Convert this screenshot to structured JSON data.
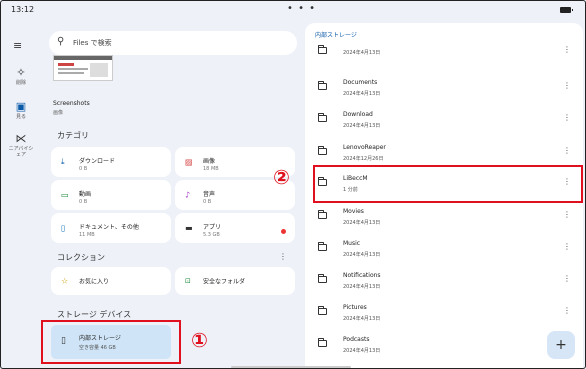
{
  "status": {
    "time": "13:12",
    "dots": "• • •"
  },
  "rail": {
    "items": [
      {
        "name": "rail-item-clean",
        "icon": "✧",
        "label": "削除"
      },
      {
        "name": "rail-item-browse",
        "icon": "▣",
        "label": "見る"
      },
      {
        "name": "rail-item-nearby-share",
        "icon": "⋉",
        "label": "ニアバイシェア"
      }
    ]
  },
  "search": {
    "placeholder": "Files で検索"
  },
  "screenshots": {
    "title": "Screenshots",
    "subtitle": "画像"
  },
  "categories": {
    "heading": "カテゴリ",
    "items": [
      {
        "name": "downloads",
        "icon": "⤓",
        "label": "ダウンロード",
        "sub": "0 B",
        "color": "#0b5aa8"
      },
      {
        "name": "images",
        "icon": "▨",
        "label": "画像",
        "sub": "18 MB",
        "color": "#d33b3b"
      },
      {
        "name": "videos",
        "icon": "▭",
        "label": "動画",
        "sub": "0 B",
        "color": "#1d8a3a"
      },
      {
        "name": "audio",
        "icon": "♪",
        "label": "音声",
        "sub": "0 B",
        "color": "#a336c9"
      },
      {
        "name": "documents",
        "icon": "▯",
        "label": "ドキュメント、その他",
        "sub": "11 MB",
        "color": "#0b6fb8"
      },
      {
        "name": "apps",
        "icon": "▬",
        "label": "アプリ",
        "sub": "5.3 GB",
        "color": "#333333"
      }
    ]
  },
  "collections": {
    "heading": "コレクション",
    "items": [
      {
        "name": "favorites",
        "icon": "☆",
        "label": "お気に入り",
        "color": "#c99b00"
      },
      {
        "name": "safe-folder",
        "icon": "🔒",
        "label": "安全なフォルダ",
        "color": "#1d8a3a"
      }
    ]
  },
  "storage": {
    "heading": "ストレージ デバイス",
    "internal": {
      "label": "内部ストレージ",
      "sub": "空き容量 46 GB"
    }
  },
  "annotations": {
    "one": "①",
    "two": "②"
  },
  "right": {
    "breadcrumb": "内部ストレージ",
    "rows": [
      {
        "name": "",
        "date": "2024年4月13日"
      },
      {
        "name": "Documents",
        "date": "2024年4月13日"
      },
      {
        "name": "Download",
        "date": "2024年4月13日"
      },
      {
        "name": "LenovoReaper",
        "date": "2024年12月26日"
      },
      {
        "name": "LiBeccM",
        "date": "1 分前"
      },
      {
        "name": "Movies",
        "date": "2024年4月13日"
      },
      {
        "name": "Music",
        "date": "2024年4月13日"
      },
      {
        "name": "Notifications",
        "date": "2024年4月13日"
      },
      {
        "name": "Pictures",
        "date": "2024年4月13日"
      },
      {
        "name": "Podcasts",
        "date": "2024年4月13日"
      }
    ],
    "fab": "+"
  },
  "colors": {
    "accent": "#0b5aa8",
    "highlight": "#e0101e",
    "selected_bg": "#cfe5f7"
  }
}
